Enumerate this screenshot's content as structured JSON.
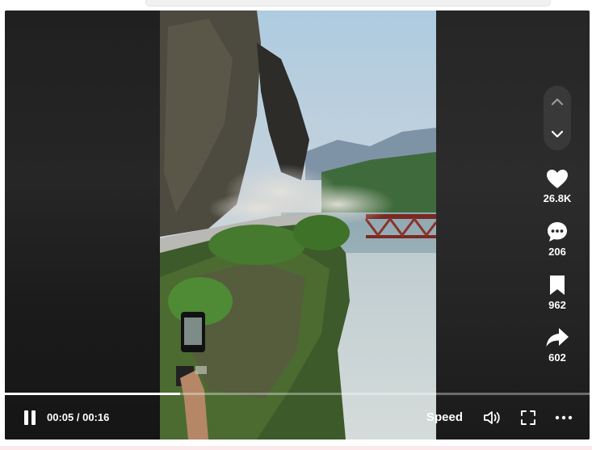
{
  "player": {
    "actions": {
      "like": {
        "icon": "heart-icon",
        "count": "26.8K"
      },
      "comment": {
        "icon": "comment-bubble-icon",
        "count": "206"
      },
      "save": {
        "icon": "bookmark-icon",
        "count": "962"
      },
      "share": {
        "icon": "share-arrow-icon",
        "count": "602"
      }
    },
    "navigation": {
      "up_icon": "chevron-up-icon",
      "down_icon": "chevron-down-icon"
    },
    "controls": {
      "time": "00:05 / 00:16",
      "progress_fraction": 0.3,
      "speed_label": "Speed",
      "pause_icon": "pause-icon",
      "volume_icon": "volume-icon",
      "fullscreen_icon": "fullscreen-icon",
      "more_icon": "more-dots-icon"
    }
  },
  "colors": {
    "control_text": "#ffffff",
    "player_background": "#111111"
  }
}
